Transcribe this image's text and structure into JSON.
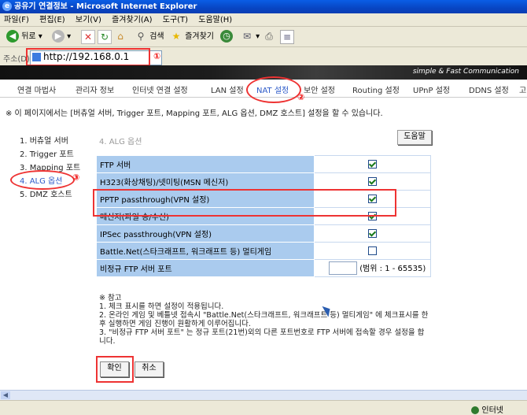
{
  "window": {
    "title": "공유기 연결정보 - Microsoft Internet Explorer"
  },
  "menu": [
    "파일(F)",
    "편집(E)",
    "보기(V)",
    "즐겨찾기(A)",
    "도구(T)",
    "도움말(H)"
  ],
  "toolbar": {
    "back": "뒤로",
    "search": "검색",
    "favorites": "즐겨찾기"
  },
  "address": {
    "label": "주소(D)",
    "url": "http://192.168.0.1"
  },
  "callouts": {
    "one": "①",
    "two": "②",
    "three": "③"
  },
  "banner": {
    "tagline": "simple & Fast Communication"
  },
  "nav": {
    "items": [
      "연결 마법사",
      "관리자 정보",
      "인터넷 연결 설정",
      "LAN 설정",
      "NAT 설정",
      "보안 설정",
      "Routing 설정",
      "UPnP 설정",
      "DDNS 설정",
      "고"
    ],
    "active_index": 4
  },
  "notice": "※ 이 페이지에서는 [버츄얼 서버, Trigger 포트, Mapping 포트, ALG 옵션, DMZ 호스트] 설정을 할 수 있습니다.",
  "sidemenu": [
    "1. 버츄얼 서버",
    "2. Trigger 포트",
    "3. Mapping 포트",
    "4. ALG 옵션",
    "5. DMZ 호스트"
  ],
  "section": {
    "title": "4. ALG 옵션",
    "help_button": "도움말"
  },
  "options": [
    {
      "label": "FTP 서버",
      "checked": true
    },
    {
      "label": "H323(화상채팅)/넷미팅(MSN 메신저)",
      "checked": true
    },
    {
      "label": "PPTP passthrough(VPN 설정)",
      "checked": true
    },
    {
      "label": "메신저(파일 송/수신)",
      "checked": true
    },
    {
      "label": "IPSec passthrough(VPN 설정)",
      "checked": true
    },
    {
      "label": "Battle.Net(스타크래프트, 워크래프트 등) 멀티게임",
      "checked": false
    }
  ],
  "ftp_port": {
    "label": "비정규 FTP 서버 포트",
    "value": "",
    "range": "(범위 : 1 - 65535)"
  },
  "notes": [
    "※ 참고",
    "1. 체크 표시를 하면 설정이 적용됩니다.",
    "2. 온라인 게임 및 베틀넷 접속시 \"Battle.Net(스타크래프트, 워크래프트 등) 멀티게임\" 에 체크표시를 한 후 실행하면 게임 진행이 원활하게 이루어집니다.",
    "3. \"비정규 FTP 서버 포트\" 는 정규 포트(21번)외의 다른 포트번호로 FTP 서버에 접속할 경우 설정을 합니다."
  ],
  "buttons": {
    "ok": "확인",
    "cancel": "취소"
  },
  "status": {
    "zone": "인터넷"
  },
  "colors": {
    "accent": "#2c5ac8",
    "annotation": "#e33333",
    "table_label_bg": "#aacbee"
  }
}
